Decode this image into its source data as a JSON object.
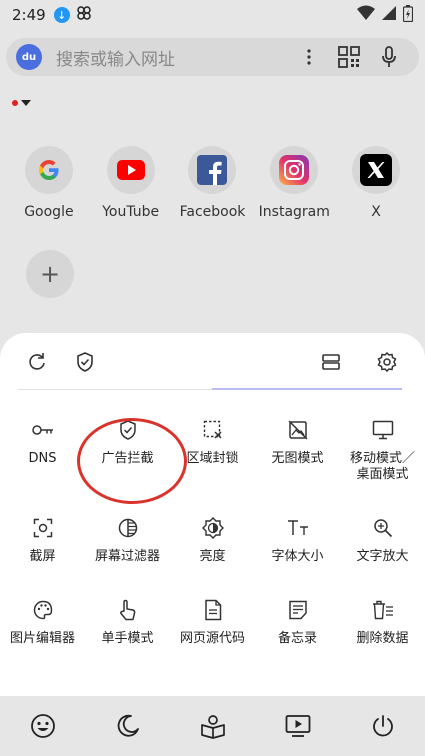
{
  "status_bar": {
    "time": "2:49"
  },
  "search": {
    "placeholder": "搜索或输入网址",
    "engine_logo": "du"
  },
  "shortcuts": [
    {
      "label": "Google",
      "icon": "google-icon"
    },
    {
      "label": "YouTube",
      "icon": "youtube-icon"
    },
    {
      "label": "Facebook",
      "icon": "facebook-icon"
    },
    {
      "label": "Instagram",
      "icon": "instagram-icon"
    },
    {
      "label": "X",
      "icon": "x-icon"
    }
  ],
  "add_shortcut": {
    "label": "+"
  },
  "tools": [
    {
      "label": "DNS",
      "icon": "key-icon"
    },
    {
      "label": "广告拦截",
      "icon": "shield-check-icon"
    },
    {
      "label": "区域封锁",
      "icon": "region-block-icon"
    },
    {
      "label": "无图模式",
      "icon": "no-image-icon"
    },
    {
      "label": "移动模式／\n桌面模式",
      "icon": "monitor-icon"
    },
    {
      "label": "截屏",
      "icon": "screenshot-icon"
    },
    {
      "label": "屏幕过滤器",
      "icon": "screen-filter-icon"
    },
    {
      "label": "亮度",
      "icon": "brightness-icon"
    },
    {
      "label": "字体大小",
      "icon": "font-size-icon"
    },
    {
      "label": "文字放大",
      "icon": "zoom-text-icon"
    },
    {
      "label": "图片编辑器",
      "icon": "palette-icon"
    },
    {
      "label": "单手模式",
      "icon": "one-hand-icon"
    },
    {
      "label": "网页源代码",
      "icon": "source-code-icon"
    },
    {
      "label": "备忘录",
      "icon": "memo-icon"
    },
    {
      "label": "删除数据",
      "icon": "delete-data-icon"
    }
  ],
  "colors": {
    "accent_underline": "#b8bcf0",
    "highlight_ring": "#d9332b"
  }
}
